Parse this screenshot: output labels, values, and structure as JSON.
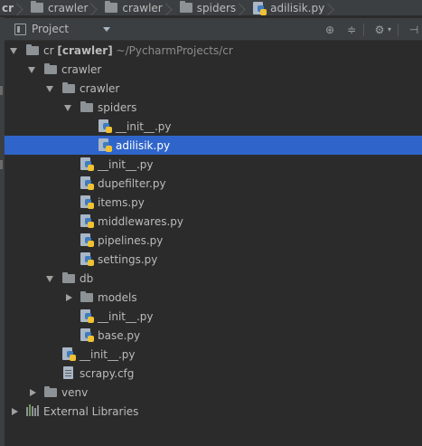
{
  "breadcrumbs": [
    "cr",
    "crawler",
    "crawler",
    "spiders",
    "adilisik.py"
  ],
  "panel": {
    "title": "Project"
  },
  "toolbar": {
    "icons": [
      "locate-icon",
      "collapse-icon",
      "gear-icon",
      "hide-icon"
    ]
  },
  "tree": {
    "root": {
      "name": "cr",
      "module": "[crawler]",
      "path": "~/PycharmProjects/cr"
    },
    "crawler": "crawler",
    "crawler_pkg": "crawler",
    "spiders": "spiders",
    "spiders_init": "__init__.py",
    "adilisik": "adilisik.py",
    "pkg_init": "__init__.py",
    "dupefilter": "dupefilter.py",
    "items": "items.py",
    "middlewares": "middlewares.py",
    "pipelines": "pipelines.py",
    "settings": "settings.py",
    "db": "db",
    "models": "models",
    "db_init": "__init__.py",
    "base": "base.py",
    "crawler_init": "__init__.py",
    "scrapy_cfg": "scrapy.cfg",
    "venv": "venv",
    "external": "External Libraries"
  },
  "colors": {
    "selection": "#2f65ca",
    "background": "#2b2b2b",
    "panel": "#3c3f41"
  }
}
